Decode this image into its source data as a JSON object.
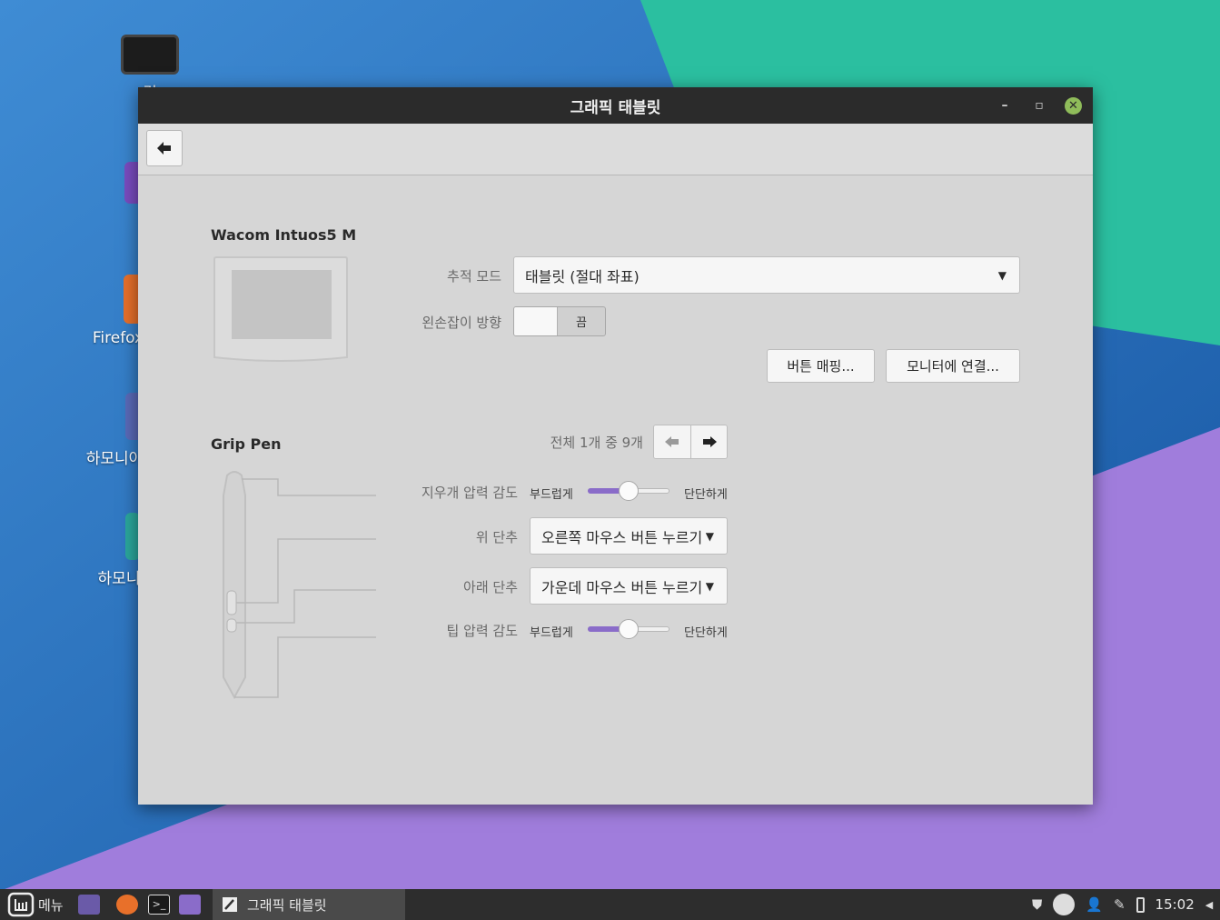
{
  "window": {
    "title": "그래픽 태블릿",
    "minimize_glyph": "–",
    "restore_glyph": "▫",
    "close_glyph": "✕",
    "back_glyph": "🡄"
  },
  "tablet": {
    "name": "Wacom Intuos5 M",
    "tracking_mode_label": "추적 모드",
    "tracking_mode_value": "태블릿 (절대 좌표)",
    "left_handed_label": "왼손잡이 방향",
    "left_handed_state": "끔",
    "button_mapping": "버튼 매핑...",
    "map_to_monitor": "모니터에 연결..."
  },
  "stylus": {
    "name": "Grip Pen",
    "page_info": "전체 1개 중 9개",
    "eraser_pressure_label": "지우개 압력 감도",
    "soft_label": "부드럽게",
    "firm_label": "단단하게",
    "eraser_pressure_value": 0.5,
    "top_button_label": "위 단추",
    "top_button_value": "오른쪽 마우스 버튼 누르기",
    "bottom_button_label": "아래 단추",
    "bottom_button_value": "가운데 마우스 버튼 누르기",
    "tip_pressure_label": "팁 압력 감도",
    "tip_pressure_value": 0.5
  },
  "desktop_icons": [
    {
      "label": "컴",
      "icon": "computer-icon"
    },
    {
      "label": "",
      "icon": "home-folder-icon"
    },
    {
      "label": "Firefox",
      "icon": "firefox-icon"
    },
    {
      "label": "하모니아",
      "icon": "app-icon"
    },
    {
      "label": "하모니",
      "icon": "app-icon"
    }
  ],
  "taskbar": {
    "menu_label": "메뉴",
    "task_label": "그래픽 태블릿",
    "clock": "15:02"
  },
  "colors": {
    "accent": "#8a6cc9",
    "titlebar": "#2b2b2b",
    "window_bg": "#d6d6d6"
  }
}
